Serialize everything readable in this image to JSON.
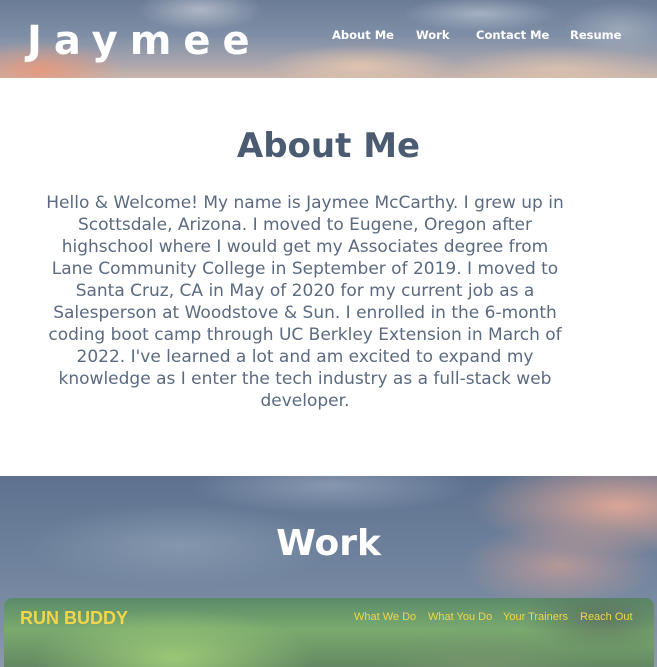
{
  "header": {
    "brand": "Jaymee",
    "nav": [
      {
        "label": "About Me"
      },
      {
        "label": "Work"
      },
      {
        "label": "Contact Me"
      },
      {
        "label": "Resume"
      }
    ]
  },
  "about": {
    "title": "About Me",
    "body": "Hello & Welcome! My name is Jaymee McCarthy. I grew up in Scottsdale, Arizona. I moved to Eugene, Oregon after highschool where I would get my Associates degree from Lane Community College in September of 2019. I moved to Santa Cruz, CA in May of 2020 for my current job as a Salesperson at Woodstove & Sun. I enrolled in the 6-month coding boot camp through UC Berkley Extension in March of 2022. I've learned a lot and am excited to expand my knowledge as I enter the tech industry as a full-stack web developer."
  },
  "work": {
    "title": "Work",
    "projects": [
      {
        "logo": "RUN BUDDY",
        "nav": [
          "What We Do",
          "What You Do",
          "Your Trainers",
          "Reach Out"
        ]
      }
    ]
  },
  "colors": {
    "heading": "#4b5c72",
    "body_text": "#5b6a80",
    "card_accent": "#f2d64a"
  }
}
